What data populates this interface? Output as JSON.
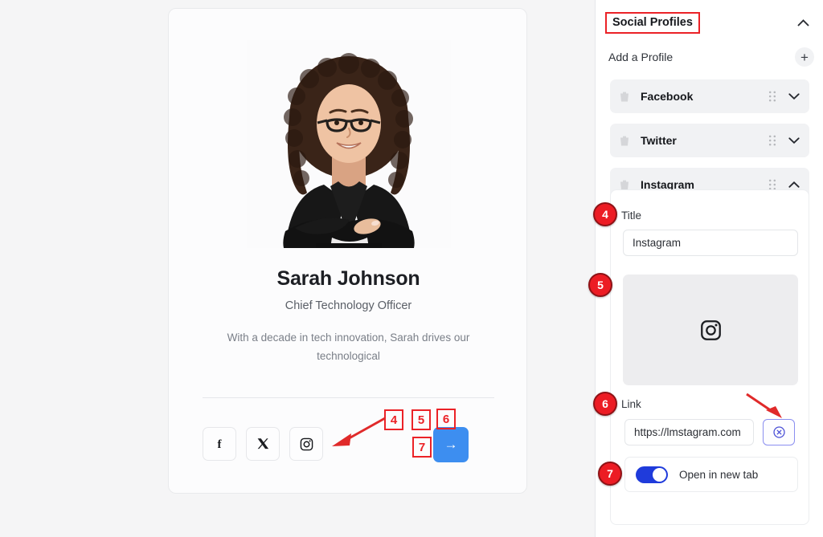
{
  "canvas": {
    "card": {
      "name": "Sarah Johnson",
      "role": "Chief Technology Officer",
      "bio": "With a decade in tech innovation, Sarah drives our technological",
      "photo_alt": "woman-portrait-photo",
      "social_buttons": [
        {
          "icon": "facebook-icon",
          "glyph": "f"
        },
        {
          "icon": "twitter-x-icon",
          "glyph": "X"
        },
        {
          "icon": "instagram-icon",
          "glyph": ""
        }
      ],
      "submit_icon": "arrow-right-icon",
      "submit_glyph": "→"
    },
    "annotations": {
      "boxes": [
        {
          "label": "4"
        },
        {
          "label": "5"
        },
        {
          "label": "6"
        },
        {
          "label": "7"
        }
      ],
      "arrow_color": "#e02a2a"
    }
  },
  "sidebar": {
    "header": {
      "title": "Social Profiles",
      "collapse_icon": "chevron-up-icon"
    },
    "add_profile": {
      "label": "Add a Profile",
      "add_icon": "plus-icon"
    },
    "profiles": [
      {
        "name": "Facebook",
        "expanded": false,
        "chevron": "chevron-down-icon",
        "delete_icon": "trash-icon",
        "drag_icon": "drag-handle-icon"
      },
      {
        "name": "Twitter",
        "expanded": false,
        "chevron": "chevron-down-icon",
        "delete_icon": "trash-icon",
        "drag_icon": "drag-handle-icon"
      },
      {
        "name": "Instagram",
        "expanded": true,
        "chevron": "chevron-up-icon",
        "delete_icon": "trash-icon",
        "drag_icon": "drag-handle-icon"
      }
    ],
    "instagram_panel": {
      "title_label": "Title",
      "title_value": "Instagram",
      "title_placeholder": "Title",
      "image_placeholder_icon": "instagram-icon",
      "link_label": "Link",
      "link_value": "https://lmstagram.com",
      "link_placeholder": "https://",
      "clear_icon": "circle-x-icon",
      "open_new_tab_label": "Open in new tab",
      "open_new_tab_enabled": true,
      "toggle_on_color": "#1f3bdb"
    },
    "badges": [
      {
        "label": "4"
      },
      {
        "label": "5"
      },
      {
        "label": "6"
      },
      {
        "label": "7"
      }
    ]
  }
}
